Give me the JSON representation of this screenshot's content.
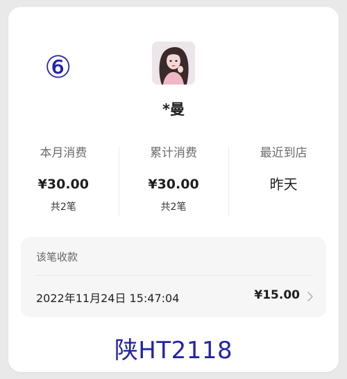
{
  "annotation": {
    "number": "⑥"
  },
  "customer": {
    "name": "*曼"
  },
  "stats": [
    {
      "label": "本月消费",
      "value": "¥30.00",
      "count": "共2笔"
    },
    {
      "label": "累计消费",
      "value": "¥30.00",
      "count": "共2笔"
    },
    {
      "label": "最近到店",
      "value": "昨天"
    }
  ],
  "receipt": {
    "title": "该笔收款",
    "datetime": "2022年11月24日 15:47:04",
    "amount": "¥15.00"
  },
  "plate": {
    "text": "陕HT2118"
  },
  "colors": {
    "annotation": "#2323a8",
    "card_background": "#ffffff",
    "page_background": "#e9e9ea",
    "receipt_background": "#f6f6f7"
  },
  "icons": {
    "avatar": "profile-photo",
    "chevron": "chevron-right-icon"
  }
}
